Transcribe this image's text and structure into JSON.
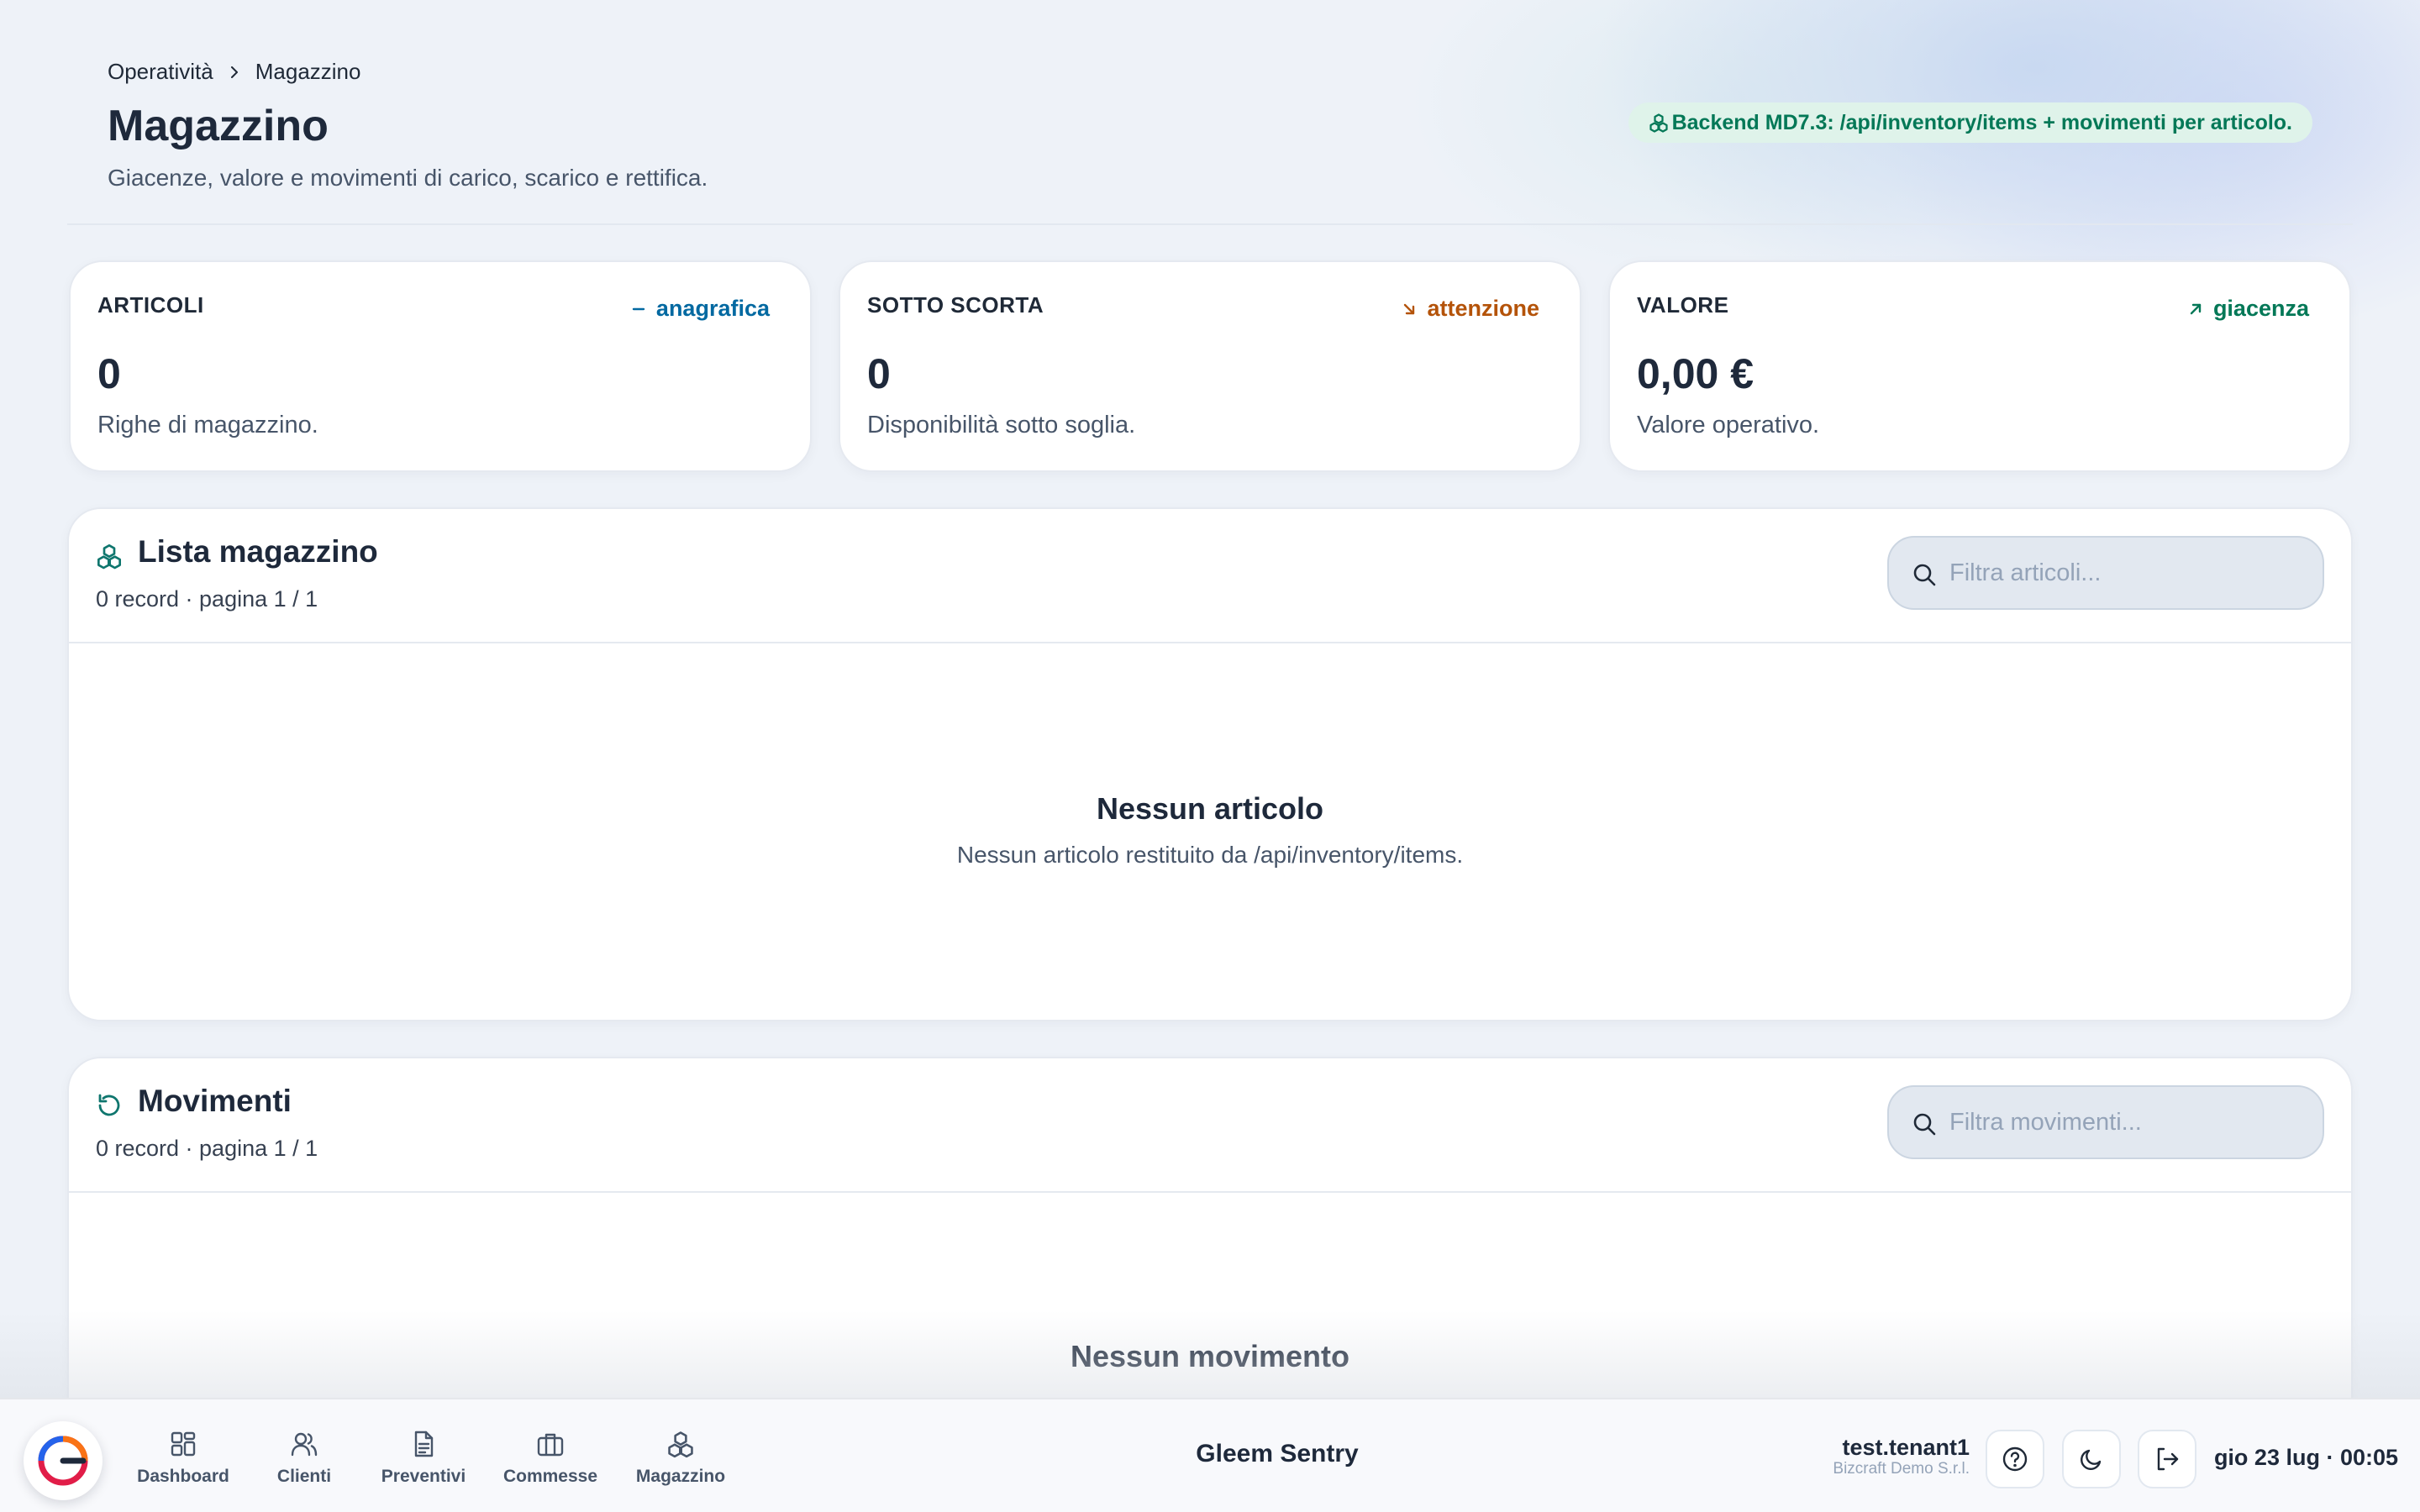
{
  "breadcrumb": {
    "parent": "Operatività",
    "current": "Magazzino"
  },
  "header": {
    "title": "Magazzino",
    "subtitle": "Giacenze, valore e movimenti di carico, scarico e rettifica.",
    "badge": "Backend MD7.3: /api/inventory/items + movimenti per articolo."
  },
  "stats": [
    {
      "label": "ARTICOLI",
      "trend": "anagrafica",
      "trend_icon": "dash-icon",
      "trend_color": "#0369a1",
      "value": "0",
      "desc": "Righe di magazzino."
    },
    {
      "label": "SOTTO SCORTA",
      "trend": "attenzione",
      "trend_icon": "arrow-down-right-icon",
      "trend_color": "#b45309",
      "value": "0",
      "desc": "Disponibilità sotto soglia."
    },
    {
      "label": "VALORE",
      "trend": "giacenza",
      "trend_icon": "arrow-up-right-icon",
      "trend_color": "#047857",
      "value": "0,00 €",
      "desc": "Valore operativo."
    }
  ],
  "inventory": {
    "title": "Lista magazzino",
    "meta": "0 record · pagina 1 / 1",
    "filter_placeholder": "Filtra articoli...",
    "empty_title": "Nessun articolo",
    "empty_desc": "Nessun articolo restituito da /api/inventory/items."
  },
  "movements": {
    "title": "Movimenti",
    "meta": "0 record · pagina 1 / 1",
    "filter_placeholder": "Filtra movimenti...",
    "empty_title": "Nessun movimento"
  },
  "nav": [
    {
      "label": "Dashboard",
      "icon": "grid-icon"
    },
    {
      "label": "Clienti",
      "icon": "users-icon"
    },
    {
      "label": "Preventivi",
      "icon": "file-text-icon"
    },
    {
      "label": "Commesse",
      "icon": "briefcase-icon"
    },
    {
      "label": "Magazzino",
      "icon": "boxes-icon"
    }
  ],
  "footer": {
    "brand": "Gleem Sentry",
    "user": "test.tenant1",
    "company": "Bizcraft Demo S.r.l.",
    "clock": "gio 23 lug · 00:05"
  },
  "colors": {
    "accent": "#0f766e",
    "badge_bg": "#dff3ea",
    "badge_text": "#047857"
  }
}
